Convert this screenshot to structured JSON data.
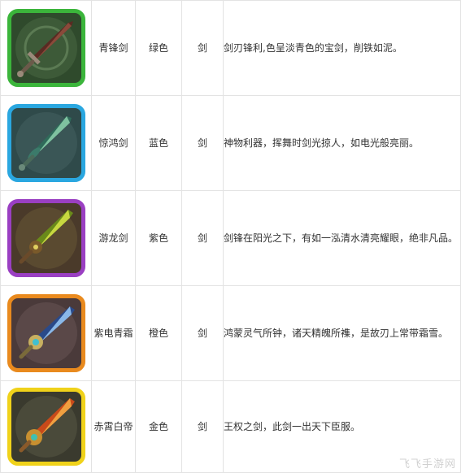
{
  "rows": [
    {
      "name": "青锋剑",
      "color": "绿色",
      "type": "剑",
      "desc": "剑刃锋利,色呈淡青色的宝剑，削铁如泥。",
      "frame_color": "#3bb53b",
      "icon": "green-sword-icon"
    },
    {
      "name": "惊鸿剑",
      "color": "蓝色",
      "type": "剑",
      "desc": "神物利器，挥舞时剑光掠人，如电光般亮丽。",
      "frame_color": "#2aa7e0",
      "icon": "blue-sword-icon"
    },
    {
      "name": "游龙剑",
      "color": "紫色",
      "type": "剑",
      "desc": "剑锋在阳光之下，有如一泓清水清亮耀眼，绝非凡品。",
      "frame_color": "#9a3fc2",
      "icon": "purple-sword-icon"
    },
    {
      "name": "紫电青霜",
      "color": "橙色",
      "type": "剑",
      "desc": "鸿蒙灵气所钟，诸天精魄所襍，是故刃上常带霜雪。",
      "frame_color": "#e98a1e",
      "icon": "orange-sword-icon"
    },
    {
      "name": "赤霄白帝",
      "color": "金色",
      "type": "剑",
      "desc": "王权之剑，此剑一出天下臣服。",
      "frame_color": "#f0d21a",
      "icon": "gold-sword-icon"
    }
  ],
  "watermark": "飞飞手游网"
}
